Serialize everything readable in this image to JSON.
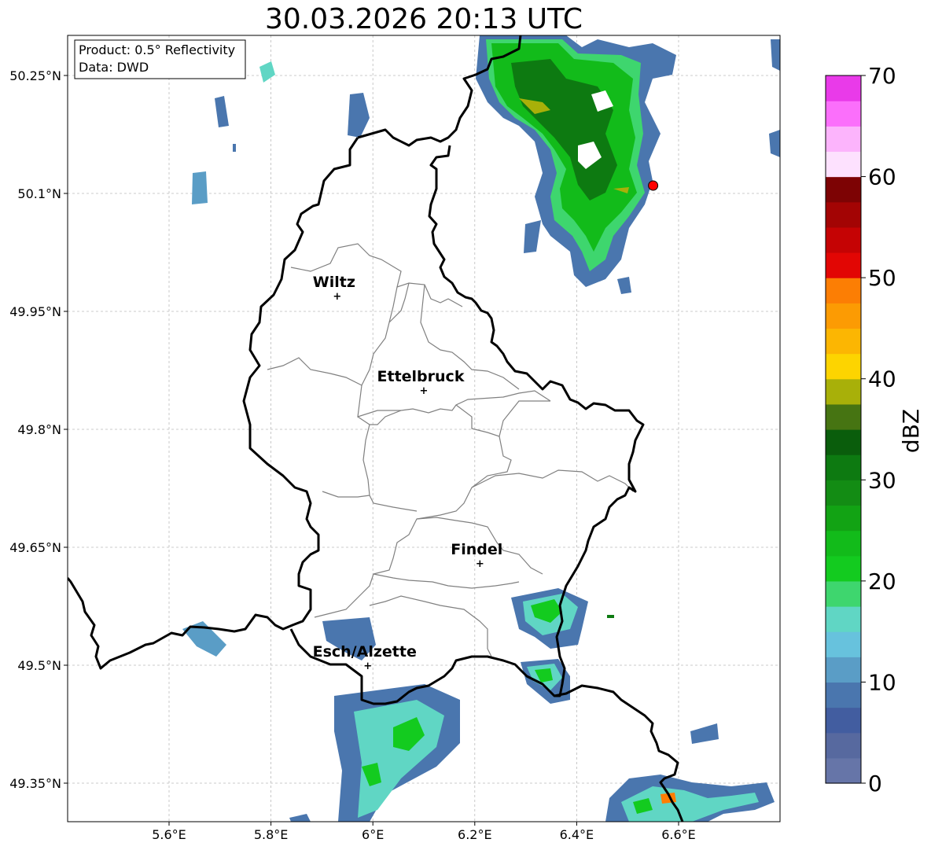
{
  "title": "30.03.2026 20:13 UTC",
  "info_box": {
    "product": "Product: 0.5° Reflectivity",
    "data": "Data: DWD"
  },
  "map": {
    "lon_range": [
      5.4,
      6.8
    ],
    "lat_range": [
      49.3,
      50.3
    ],
    "x_ticks": [
      "5.6°E",
      "5.8°E",
      "6°E",
      "6.2°E",
      "6.4°E",
      "6.6°E"
    ],
    "x_tick_values": [
      5.6,
      5.8,
      6.0,
      6.2,
      6.4,
      6.6
    ],
    "y_ticks": [
      "50.25°N",
      "50.1°N",
      "49.95°N",
      "49.8°N",
      "49.65°N",
      "49.5°N",
      "49.35°N"
    ],
    "y_tick_values": [
      50.25,
      50.1,
      49.95,
      49.8,
      49.65,
      49.5,
      49.35
    ],
    "grid": true,
    "cities": [
      {
        "name": "Wiltz",
        "lon": 5.93,
        "lat": 49.97
      },
      {
        "name": "Ettelbruck",
        "lon": 6.1,
        "lat": 49.85
      },
      {
        "name": "Findel",
        "lon": 6.21,
        "lat": 49.63
      },
      {
        "name": "Esch/Alzette",
        "lon": 5.99,
        "lat": 49.5
      }
    ],
    "radar_site": {
      "lon": 6.55,
      "lat": 50.11,
      "color": "#ff0000"
    }
  },
  "colorbar": {
    "label": "dBZ",
    "min": 0,
    "max": 70,
    "ticks": [
      "0",
      "10",
      "20",
      "30",
      "40",
      "50",
      "60",
      "70"
    ],
    "colors": [
      "#6675a8",
      "#57699f",
      "#425da0",
      "#4a76ae",
      "#5a9dc6",
      "#67c2dd",
      "#60d6c4",
      "#3ed66e",
      "#13cb1f",
      "#12bb1a",
      "#12a314",
      "#138c14",
      "#0d7a11",
      "#0a5d0c",
      "#467412",
      "#a8b009",
      "#fdd400",
      "#fcb602",
      "#fc9b03",
      "#fc7e04",
      "#e20604",
      "#c50304",
      "#a30404",
      "#7d0304",
      "#fde1fe",
      "#fcb4fc",
      "#fb6ffb",
      "#e93ae9"
    ]
  }
}
